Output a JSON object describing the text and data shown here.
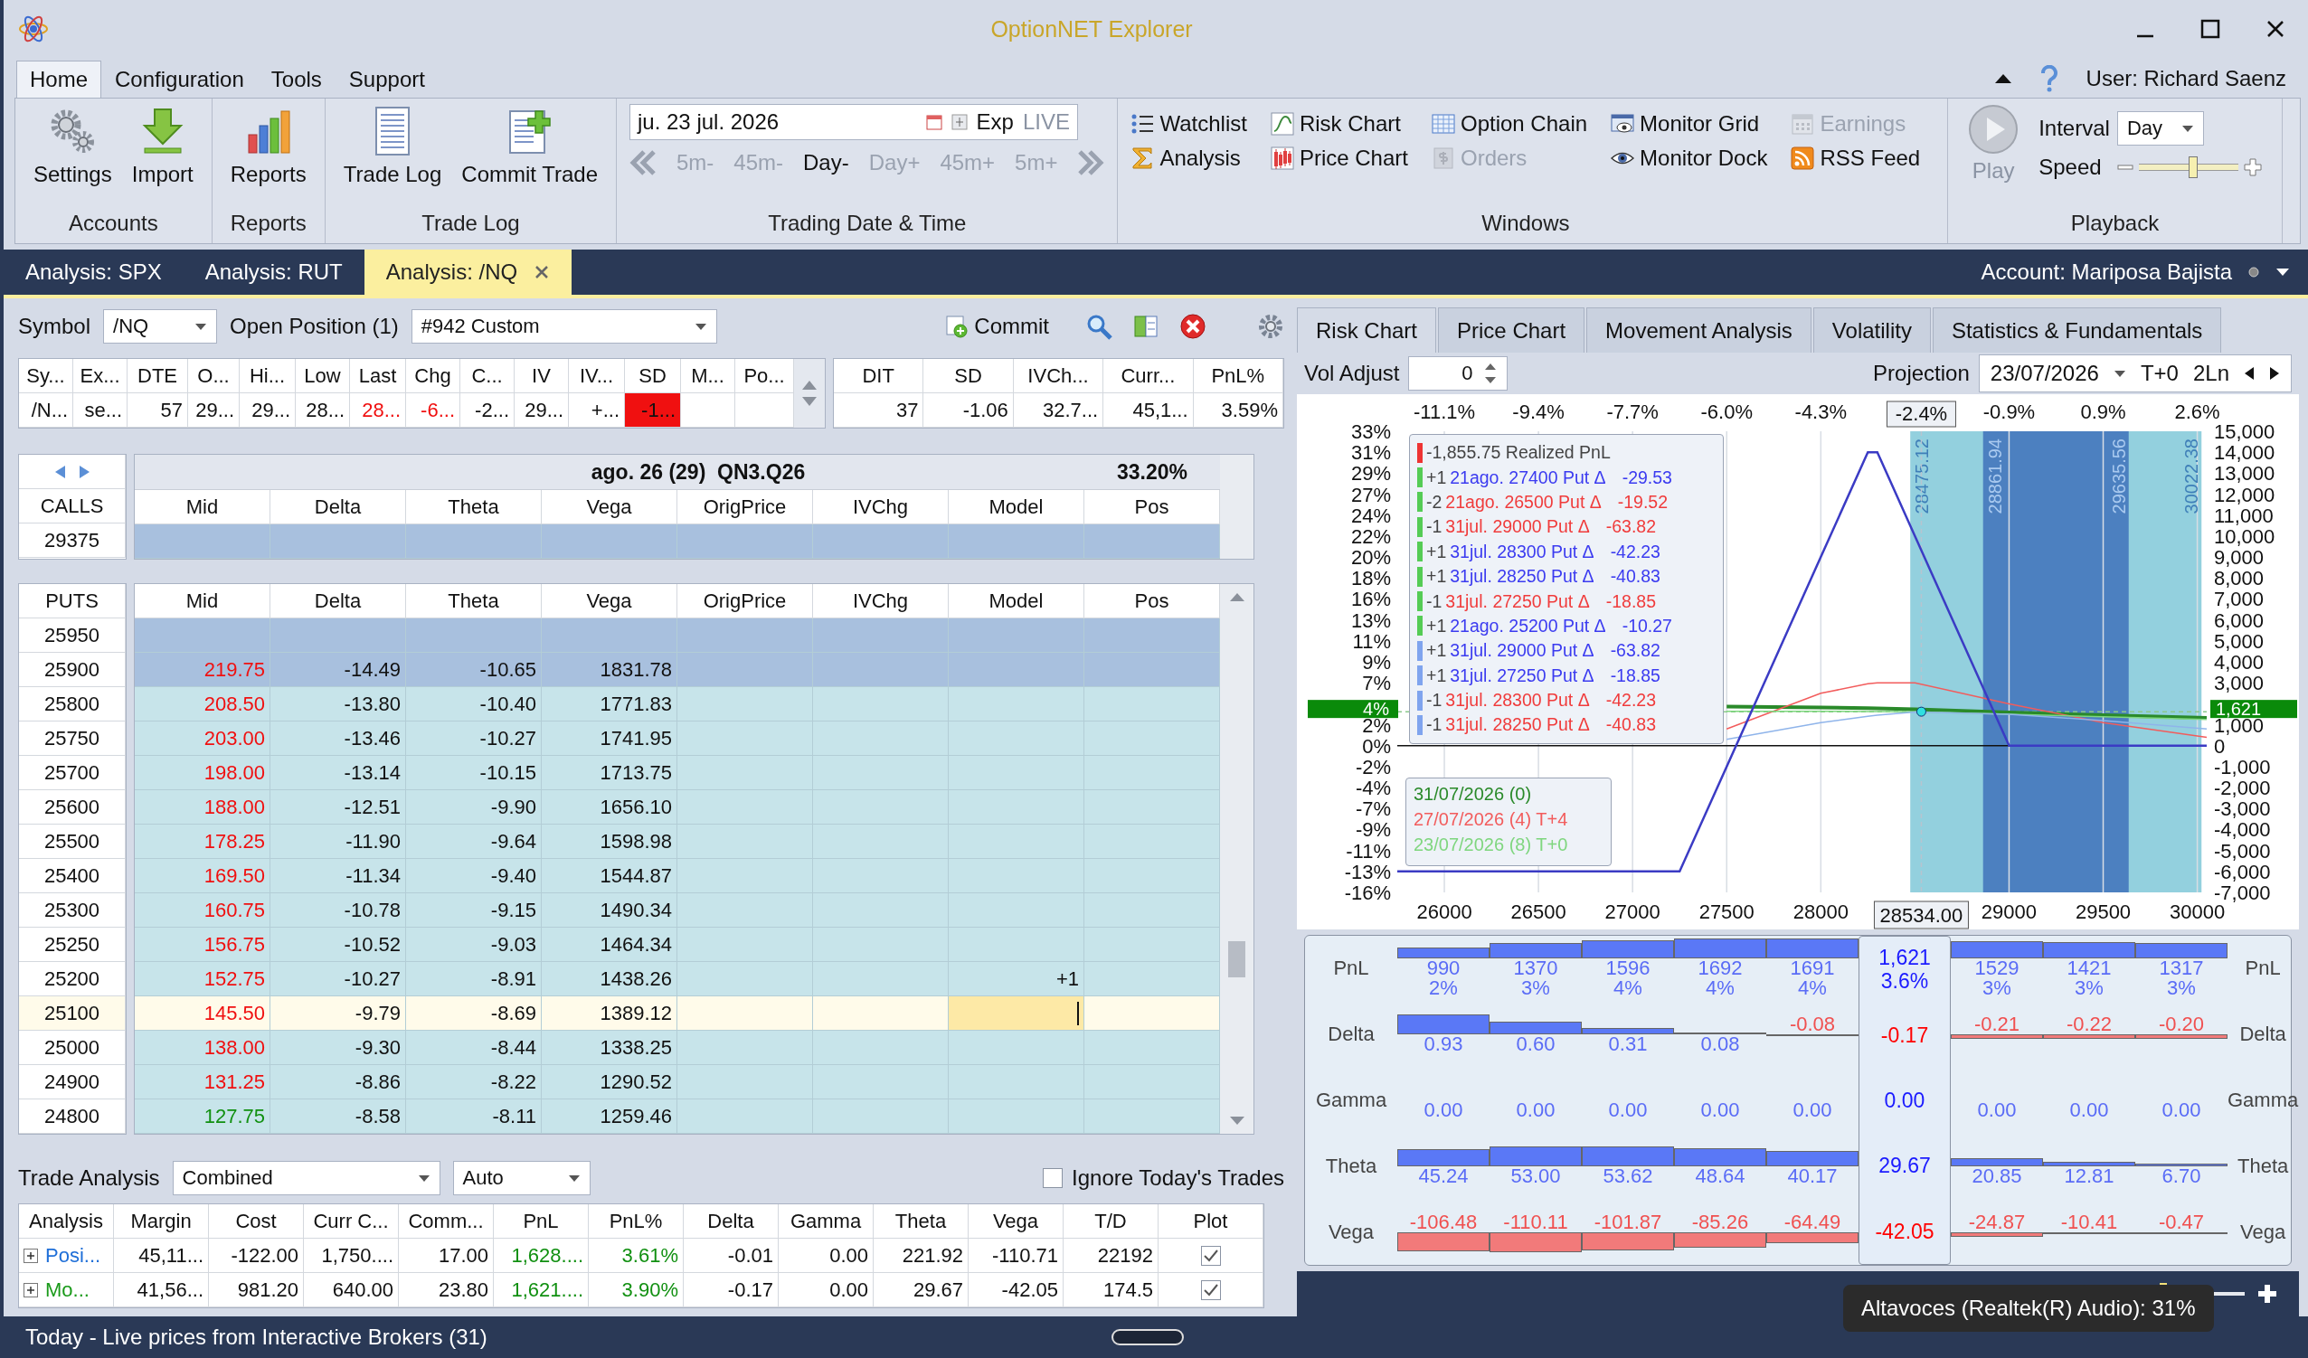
{
  "window": {
    "title": "OptionNET Explorer"
  },
  "menu": {
    "tabs": [
      {
        "label": "Home",
        "selected": true
      },
      {
        "label": "Configuration",
        "selected": false
      },
      {
        "label": "Tools",
        "selected": false
      },
      {
        "label": "Support",
        "selected": false
      }
    ],
    "user": "User: Richard Saenz"
  },
  "ribbon": {
    "groups": [
      {
        "title": "Accounts",
        "items": [
          {
            "label": "Settings",
            "kind": "gears"
          },
          {
            "label": "Import",
            "kind": "download"
          }
        ]
      },
      {
        "title": "Reports",
        "items": [
          {
            "label": "Reports",
            "kind": "bars"
          }
        ]
      },
      {
        "title": "Trade Log",
        "items": [
          {
            "label": "Trade Log",
            "kind": "doc"
          },
          {
            "label": "Commit Trade",
            "kind": "docplus"
          }
        ]
      }
    ],
    "datetime": {
      "title": "Trading Date & Time",
      "date": "ju. 23 jul. 2026",
      "exp": "Exp",
      "live": "LIVE",
      "steps": [
        {
          "label": "5m-",
          "disabled": true
        },
        {
          "label": "45m-",
          "disabled": true
        },
        {
          "label": "Day-",
          "disabled": false
        },
        {
          "label": "Day+",
          "disabled": true
        },
        {
          "label": "45m+",
          "disabled": true
        },
        {
          "label": "5m+",
          "disabled": true
        }
      ]
    },
    "windows": {
      "title": "Windows",
      "items": [
        {
          "label": "Watchlist",
          "kind": "list",
          "disabled": false
        },
        {
          "label": "Risk Chart",
          "kind": "curve",
          "disabled": false
        },
        {
          "label": "Option Chain",
          "kind": "grid",
          "disabled": false
        },
        {
          "label": "Monitor Grid",
          "kind": "monitor",
          "disabled": false
        },
        {
          "label": "Earnings",
          "kind": "calendar",
          "disabled": true
        },
        {
          "label": "Analysis",
          "kind": "sigma",
          "disabled": false
        },
        {
          "label": "Price Chart",
          "kind": "candles",
          "disabled": false
        },
        {
          "label": "Orders",
          "kind": "dollar",
          "disabled": true
        },
        {
          "label": "Monitor Dock",
          "kind": "eye",
          "disabled": false
        },
        {
          "label": "RSS Feed",
          "kind": "rss",
          "disabled": false
        }
      ]
    },
    "playback": {
      "title": "Playback",
      "play": {
        "label": "Play",
        "disabled": true
      },
      "interval_label": "Interval",
      "interval": "Day",
      "speed_label": "Speed",
      "speed": {
        "level": 0.55
      }
    }
  },
  "doc_tabs": [
    {
      "label": "Analysis: SPX",
      "selected": false,
      "closable": false
    },
    {
      "label": "Analysis: RUT",
      "selected": false,
      "closable": false
    },
    {
      "label": "Analysis: /NQ",
      "selected": true,
      "closable": true
    }
  ],
  "account": "Account: Mariposa Bajista",
  "toolbar": {
    "symbol_label": "Symbol",
    "symbol": "/NQ",
    "position_label": "Open Position (1)",
    "position": "#942 Custom",
    "commit": "Commit"
  },
  "quote": {
    "columns": [
      "Sy...",
      "Ex...",
      "DTE",
      "O...",
      "Hi...",
      "Low",
      "Last",
      "Chg",
      "C...",
      "IV",
      "IV...",
      "SD",
      "M...",
      "Po..."
    ],
    "cells": [
      {
        "text": "/N..."
      },
      {
        "text": "se..."
      },
      {
        "text": "57"
      },
      {
        "text": "29..."
      },
      {
        "text": "29..."
      },
      {
        "text": "28..."
      },
      {
        "text": "28...",
        "negative": true
      },
      {
        "text": "-6...",
        "negative": true
      },
      {
        "text": "-2..."
      },
      {
        "text": "29..."
      },
      {
        "text": "+..."
      },
      {
        "text": "-1...",
        "alert": true
      },
      {},
      {}
    ]
  },
  "summary": {
    "columns": [
      "DIT",
      "SD",
      "IVCh...",
      "Curr...",
      "PnL%"
    ],
    "values": [
      "37",
      "-1.06",
      "32.7...",
      "45,1...",
      "3.59%"
    ]
  },
  "chain": {
    "expiry": "ago. 26 (29)",
    "code": "QN3.Q26",
    "iv": "33.20%",
    "calls": {
      "label": "CALLS",
      "columns": [
        "Mid",
        "Delta",
        "Theta",
        "Vega",
        "OrigPrice",
        "IVChg",
        "Model",
        "Pos"
      ],
      "rows": [
        {
          "strike": "29375",
          "selected": true,
          "current": false,
          "editing": false
        }
      ]
    },
    "puts": {
      "label": "PUTS",
      "columns": [
        "Mid",
        "Delta",
        "Theta",
        "Vega",
        "OrigPrice",
        "IVChg",
        "Model",
        "Pos"
      ],
      "rows": [
        {
          "strike": "25950",
          "selected": true,
          "current": false,
          "editing": false
        },
        {
          "strike": "25900",
          "mid": "219.75",
          "delta": "-14.49",
          "theta": "-10.65",
          "vega": "1831.78",
          "rising": false,
          "selected": true,
          "current": false,
          "editing": false
        },
        {
          "strike": "25800",
          "mid": "208.50",
          "delta": "-13.80",
          "theta": "-10.40",
          "vega": "1771.83",
          "rising": false,
          "selected": false,
          "current": false,
          "editing": false
        },
        {
          "strike": "25750",
          "mid": "203.00",
          "delta": "-13.46",
          "theta": "-10.27",
          "vega": "1741.95",
          "rising": false,
          "selected": false,
          "current": false,
          "editing": false
        },
        {
          "strike": "25700",
          "mid": "198.00",
          "delta": "-13.14",
          "theta": "-10.15",
          "vega": "1713.75",
          "rising": false,
          "selected": false,
          "current": false,
          "editing": false
        },
        {
          "strike": "25600",
          "mid": "188.00",
          "delta": "-12.51",
          "theta": "-9.90",
          "vega": "1656.10",
          "rising": false,
          "selected": false,
          "current": false,
          "editing": false
        },
        {
          "strike": "25500",
          "mid": "178.25",
          "delta": "-11.90",
          "theta": "-9.64",
          "vega": "1598.98",
          "rising": false,
          "selected": false,
          "current": false,
          "editing": false
        },
        {
          "strike": "25400",
          "mid": "169.50",
          "delta": "-11.34",
          "theta": "-9.40",
          "vega": "1544.87",
          "rising": false,
          "selected": false,
          "current": false,
          "editing": false
        },
        {
          "strike": "25300",
          "mid": "160.75",
          "delta": "-10.78",
          "theta": "-9.15",
          "vega": "1490.34",
          "rising": false,
          "selected": false,
          "current": false,
          "editing": false
        },
        {
          "strike": "25250",
          "mid": "156.75",
          "delta": "-10.52",
          "theta": "-9.03",
          "vega": "1464.34",
          "rising": false,
          "selected": false,
          "current": false,
          "editing": false
        },
        {
          "strike": "25200",
          "mid": "152.75",
          "delta": "-10.27",
          "theta": "-8.91",
          "vega": "1438.26",
          "model": "+1",
          "rising": false,
          "selected": false,
          "current": false,
          "editing": false
        },
        {
          "strike": "25100",
          "mid": "145.50",
          "delta": "-9.79",
          "theta": "-8.69",
          "vega": "1389.12",
          "rising": false,
          "selected": false,
          "current": true,
          "editing": true
        },
        {
          "strike": "25000",
          "mid": "138.00",
          "delta": "-9.30",
          "theta": "-8.44",
          "vega": "1338.25",
          "rising": false,
          "selected": false,
          "current": false,
          "editing": false
        },
        {
          "strike": "24900",
          "mid": "131.25",
          "delta": "-8.86",
          "theta": "-8.22",
          "vega": "1290.52",
          "rising": false,
          "selected": false,
          "current": false,
          "editing": false
        },
        {
          "strike": "24800",
          "mid": "127.75",
          "delta": "-8.58",
          "theta": "-8.11",
          "vega": "1259.46",
          "rising": true,
          "selected": false,
          "current": false,
          "editing": false
        }
      ]
    }
  },
  "trade_analysis": {
    "label": "Trade Analysis",
    "mode": "Combined",
    "range": "Auto",
    "ignore_today": {
      "label": "Ignore Today's Trades",
      "checked": false
    },
    "columns": [
      "Analysis",
      "Margin",
      "Cost",
      "Curr C...",
      "Comm...",
      "PnL",
      "PnL%",
      "Delta",
      "Gamma",
      "Theta",
      "Vega",
      "T/D",
      "Plot"
    ],
    "rows": [
      {
        "expanded": false,
        "cells": [
          {
            "text": "Posi...",
            "color": "#1f6fd8"
          },
          {
            "text": "45,11..."
          },
          {
            "text": "-122.00"
          },
          {
            "text": "1,750...."
          },
          {
            "text": "17.00"
          },
          {
            "text": "1,628....",
            "positive": true
          },
          {
            "text": "3.61%",
            "positive": true
          },
          {
            "text": "-0.01"
          },
          {
            "text": "0.00"
          },
          {
            "text": "221.92"
          },
          {
            "text": "-110.71"
          },
          {
            "text": "22192"
          },
          {
            "checked": true
          }
        ]
      },
      {
        "expanded": false,
        "cells": [
          {
            "text": "Mo...",
            "color": "#1a9a1a"
          },
          {
            "text": "41,56..."
          },
          {
            "text": "981.20"
          },
          {
            "text": "640.00"
          },
          {
            "text": "23.80"
          },
          {
            "text": "1,621....",
            "positive": true
          },
          {
            "text": "3.90%",
            "positive": true
          },
          {
            "text": "-0.17"
          },
          {
            "text": "0.00"
          },
          {
            "text": "29.67"
          },
          {
            "text": "-42.05"
          },
          {
            "text": "174.5"
          },
          {
            "checked": true
          }
        ]
      }
    ]
  },
  "risk": {
    "tabs": [
      {
        "label": "Risk Chart",
        "selected": true
      },
      {
        "label": "Price Chart",
        "selected": false
      },
      {
        "label": "Movement Analysis",
        "selected": false
      },
      {
        "label": "Volatility",
        "selected": false
      },
      {
        "label": "Statistics & Fundamentals",
        "selected": false
      }
    ],
    "vol_label": "Vol Adjust",
    "vol": "0",
    "projection_label": "Projection",
    "projection": "23/07/2026",
    "offset": "T+0",
    "lines": "2Ln",
    "positions": [
      {
        "kind": "realized",
        "text": "-1,855.75 Realized PnL",
        "color": "#444444"
      },
      {
        "kind": "open",
        "qty": "+1",
        "text": "21ago. 27400 Put Δ",
        "delta": "-29.53",
        "color": "#3b3bf0"
      },
      {
        "kind": "open",
        "qty": "-2",
        "text": "21ago. 26500 Put Δ",
        "delta": "-19.52",
        "color": "#f03c3c"
      },
      {
        "kind": "open",
        "qty": "-1",
        "text": "31jul. 29000 Put Δ",
        "delta": "-63.82",
        "color": "#f03c3c"
      },
      {
        "kind": "open",
        "qty": "+1",
        "text": "31jul. 28300 Put Δ",
        "delta": "-42.23",
        "color": "#3b3bf0"
      },
      {
        "kind": "open",
        "qty": "+1",
        "text": "31jul. 28250 Put Δ",
        "delta": "-40.83",
        "color": "#3b3bf0"
      },
      {
        "kind": "open",
        "qty": "-1",
        "text": "31jul. 27250 Put Δ",
        "delta": "-18.85",
        "color": "#f03c3c"
      },
      {
        "kind": "open",
        "qty": "+1",
        "text": "21ago. 25200 Put Δ",
        "delta": "-10.27",
        "color": "#3b3bf0"
      },
      {
        "kind": "closed",
        "qty": "+1",
        "text": "31jul. 29000 Put Δ",
        "delta": "-63.82",
        "color": "#3b3bf0"
      },
      {
        "kind": "closed",
        "qty": "+1",
        "text": "31jul. 27250 Put Δ",
        "delta": "-18.85",
        "color": "#3b3bf0"
      },
      {
        "kind": "closed",
        "qty": "-1",
        "text": "31jul. 28300 Put Δ",
        "delta": "-42.23",
        "color": "#f03c3c"
      },
      {
        "kind": "closed",
        "qty": "-1",
        "text": "31jul. 28250 Put Δ",
        "delta": "-40.83",
        "color": "#f03c3c"
      }
    ],
    "top_axis": [
      "-11.1%",
      "-9.4%",
      "-7.7%",
      "-6.0%",
      "-4.3%",
      "-0.9%",
      "0.9%",
      "2.6%"
    ],
    "left_axis": [
      "33%",
      "31%",
      "29%",
      "27%",
      "24%",
      "22%",
      "20%",
      "18%",
      "16%",
      "13%",
      "11%",
      "9%",
      "7%",
      "2%",
      "0%",
      "-2%",
      "-4%",
      "-7%",
      "-9%",
      "-11%",
      "-13%",
      "-16%"
    ],
    "band_labels": [
      {
        "low": "28475.12",
        "high": "30022.38"
      },
      {
        "low": "28861.94",
        "high": "29635.56"
      }
    ],
    "spot_change": "-2.4%",
    "current_percent": "4%",
    "chart_data": {
      "type": "line",
      "grid": true,
      "x": [
        25750,
        26000,
        26500,
        27000,
        27250,
        27500,
        28000,
        28250,
        28300,
        28500,
        29000,
        29500,
        30050
      ],
      "xlim": [
        25750,
        30050
      ],
      "ylim": [
        -7000,
        15000
      ],
      "xticks": [
        26000,
        26500,
        27000,
        27500,
        28000,
        29000,
        29500,
        30000
      ],
      "yticks": [
        {
          "value": 15000,
          "label": "15,000"
        },
        {
          "value": 14000,
          "label": "14,000"
        },
        {
          "value": 13000,
          "label": "13,000"
        },
        {
          "value": 12000,
          "label": "12,000"
        },
        {
          "value": 11000,
          "label": "11,000"
        },
        {
          "value": 10000,
          "label": "10,000"
        },
        {
          "value": 9000,
          "label": "9,000"
        },
        {
          "value": 8000,
          "label": "8,000"
        },
        {
          "value": 7000,
          "label": "7,000"
        },
        {
          "value": 6000,
          "label": "6,000"
        },
        {
          "value": 5000,
          "label": "5,000"
        },
        {
          "value": 4000,
          "label": "4,000"
        },
        {
          "value": 3000,
          "label": "3,000"
        },
        {
          "value": 1000,
          "label": "1,000"
        },
        {
          "value": 0,
          "label": "0"
        },
        {
          "value": -1000,
          "label": "-1,000"
        },
        {
          "value": -2000,
          "label": "-2,000"
        },
        {
          "value": -3000,
          "label": "-3,000"
        },
        {
          "value": -4000,
          "label": "-4,000"
        },
        {
          "value": -5000,
          "label": "-5,000"
        },
        {
          "value": -6000,
          "label": "-6,000"
        },
        {
          "value": -7000,
          "label": "-7,000"
        }
      ],
      "series": [
        {
          "name": "31/07/2026 (0)",
          "color": "#2a8a2a",
          "values": [
            null,
            null,
            null,
            null,
            null,
            1870,
            1820,
            1790,
            1780,
            1730,
            1580,
            1450,
            1320
          ]
        },
        {
          "name": "27/07/2026 (4) T+4",
          "color": "#f25c5c",
          "values": [
            null,
            null,
            null,
            null,
            null,
            800,
            2500,
            2950,
            3000,
            3000,
            2000,
            1100,
            400
          ]
        },
        {
          "name": "23/07/2026 (8) T+0",
          "color": "#7fd67f",
          "values": [
            null,
            null,
            null,
            null,
            null,
            1640,
            1640,
            1630,
            1630,
            1620,
            1500,
            1380,
            1250
          ]
        },
        {
          "color": "#8fb4ea",
          "values": [
            null,
            null,
            null,
            null,
            null,
            300,
            1100,
            1400,
            1450,
            1600,
            1500,
            1200,
            800
          ]
        },
        {
          "color": "#3b3bc4",
          "values": [
            -6000,
            -6000,
            -6000,
            -6000,
            -6000,
            -1000,
            9000,
            14000,
            14000,
            10000,
            0,
            0,
            0
          ]
        }
      ],
      "bands": [
        {
          "axis": "x",
          "from": 28475.12,
          "to": 30022.38,
          "color": "#93d0de"
        },
        {
          "axis": "x",
          "from": 28861.94,
          "to": 29635.56,
          "color": "#4c80c0"
        }
      ],
      "ref_lines": [
        {
          "axis": "x",
          "value": 28534,
          "label": "28534.00"
        },
        {
          "axis": "y",
          "value": 1621,
          "label": "1,621"
        }
      ]
    },
    "greeks": [
      {
        "label": "PnL",
        "right_label": "PnL",
        "cells": [
          {
            "value": "990",
            "sub": "2%",
            "negative": false
          },
          {
            "value": "1370",
            "sub": "3%",
            "negative": false
          },
          {
            "value": "1596",
            "sub": "4%",
            "negative": false
          },
          {
            "value": "1692",
            "sub": "4%",
            "negative": false
          },
          {
            "value": "1691",
            "sub": "4%",
            "negative": false
          },
          {
            "kind": "spot",
            "value": "1,621",
            "sub": "3.6%",
            "negative": false
          },
          {
            "value": "1529",
            "sub": "3%",
            "negative": false
          },
          {
            "value": "1421",
            "sub": "3%",
            "negative": false
          },
          {
            "value": "1317",
            "sub": "3%",
            "negative": false
          }
        ]
      },
      {
        "label": "Delta",
        "right_label": "Delta",
        "cells": [
          {
            "value": "0.93",
            "negative": false
          },
          {
            "value": "0.60",
            "negative": false
          },
          {
            "value": "0.31",
            "negative": false
          },
          {
            "value": "0.08",
            "negative": false
          },
          {
            "value": "-0.08",
            "negative": true
          },
          {
            "kind": "spot",
            "value": "-0.17",
            "negative": true
          },
          {
            "value": "-0.21",
            "negative": true
          },
          {
            "value": "-0.22",
            "negative": true
          },
          {
            "value": "-0.20",
            "negative": true
          }
        ]
      },
      {
        "label": "Gamma",
        "right_label": "Gamma",
        "cells": [
          {
            "value": "0.00",
            "negative": false
          },
          {
            "value": "0.00",
            "negative": false
          },
          {
            "value": "0.00",
            "negative": false
          },
          {
            "value": "0.00",
            "negative": false
          },
          {
            "value": "0.00",
            "negative": false
          },
          {
            "kind": "spot",
            "value": "0.00",
            "negative": false
          },
          {
            "value": "0.00",
            "negative": false
          },
          {
            "value": "0.00",
            "negative": false
          },
          {
            "value": "0.00",
            "negative": false
          }
        ]
      },
      {
        "label": "Theta",
        "right_label": "Theta",
        "cells": [
          {
            "value": "45.24",
            "negative": false
          },
          {
            "value": "53.00",
            "negative": false
          },
          {
            "value": "53.62",
            "negative": false
          },
          {
            "value": "48.64",
            "negative": false
          },
          {
            "value": "40.17",
            "negative": false
          },
          {
            "kind": "spot",
            "value": "29.67",
            "negative": false
          },
          {
            "value": "20.85",
            "negative": false
          },
          {
            "value": "12.81",
            "negative": false
          },
          {
            "value": "6.70",
            "negative": false
          }
        ]
      },
      {
        "label": "Vega",
        "right_label": "Vega",
        "cells": [
          {
            "value": "-106.48",
            "negative": true
          },
          {
            "value": "-110.11",
            "negative": true
          },
          {
            "value": "-101.87",
            "negative": true
          },
          {
            "value": "-85.26",
            "negative": true
          },
          {
            "value": "-64.49",
            "negative": true
          },
          {
            "kind": "spot",
            "value": "-42.05",
            "negative": true
          },
          {
            "value": "-24.87",
            "negative": true
          },
          {
            "value": "-10.41",
            "negative": true
          },
          {
            "value": "-0.47",
            "negative": true
          }
        ]
      }
    ],
    "zoom_slider": {
      "level": 0.25
    }
  },
  "status_bar": "Today - Live prices from Interactive Brokers (31)",
  "tooltip": "Altavoces (Realtek(R) Audio): 31%"
}
